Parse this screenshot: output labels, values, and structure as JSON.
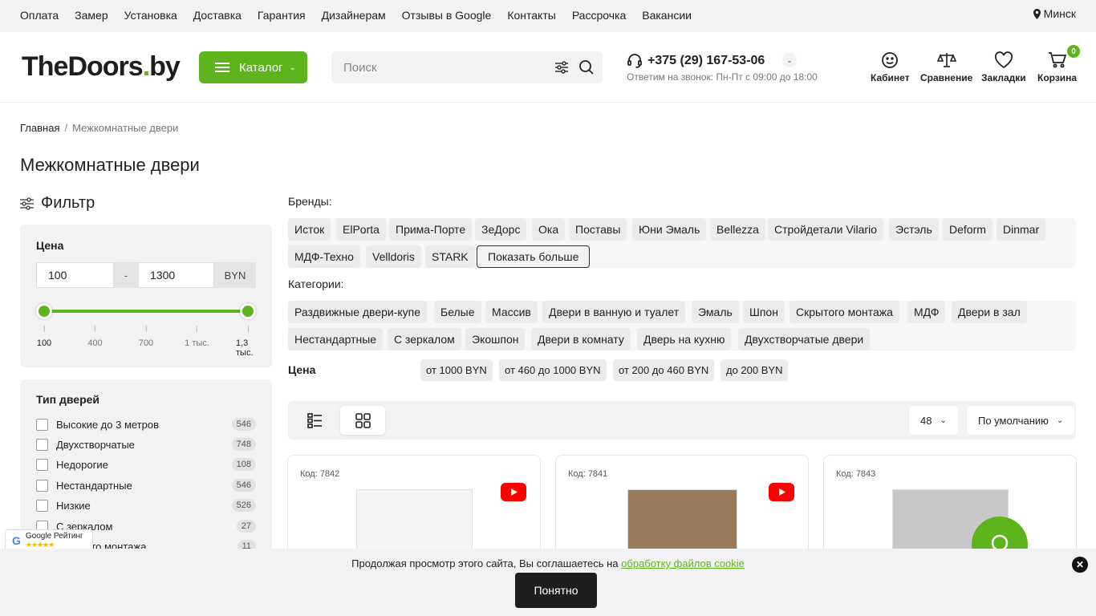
{
  "topnav": {
    "links": [
      "Оплата",
      "Замер",
      "Установка",
      "Доставка",
      "Гарантия",
      "Дизайнерам",
      "Отзывы в Google",
      "Контакты",
      "Рассрочка",
      "Вакансии"
    ],
    "city": "Минск"
  },
  "header": {
    "logo_main": "TheDoors",
    "logo_dot": ".",
    "logo_tld": "by",
    "catalog_label": "Каталог",
    "search_placeholder": "Поиск",
    "phone": "+375 (29) 167-53-06",
    "hours": "Ответим на звонок: Пн-Пт с 09:00 до 18:00",
    "cabinet": "Кабинет",
    "compare": "Сравнение",
    "bookmarks": "Закладки",
    "cart": "Корзина",
    "cart_count": "0"
  },
  "breadcrumb": {
    "home": "Главная",
    "sep": "/",
    "current": "Межкомнатные двери"
  },
  "page_title": "Межкомнатные двери",
  "filter": {
    "title": "Фильтр",
    "price": {
      "title": "Цена",
      "min": "100",
      "dash": "-",
      "max": "1300",
      "currency": "BYN",
      "range_fraction": [
        0,
        1
      ],
      "ticks": [
        "100",
        "400",
        "700",
        "1 тыс.",
        "1,3 тыс."
      ]
    },
    "door_type": {
      "title": "Тип дверей",
      "items": [
        {
          "label": "Высокие до 3 метров",
          "count": "546"
        },
        {
          "label": "Двухстворчатые",
          "count": "748"
        },
        {
          "label": "Недорогие",
          "count": "108"
        },
        {
          "label": "Нестандартные",
          "count": "546"
        },
        {
          "label": "Низкие",
          "count": "526"
        },
        {
          "label": "С зеркалом",
          "count": "27"
        },
        {
          "label": "Скрытого монтажа",
          "count": "11"
        }
      ]
    }
  },
  "brands": {
    "label": "Бренды:",
    "items": [
      "Исток",
      "ElPorta",
      "Прима-Порте",
      "ЗеДорс",
      "Ока",
      "Поставы",
      "Юни Эмаль",
      "Bellezza",
      "Стройдетали Vilario",
      "Эстэль",
      "Deform",
      "Dinmar",
      "МДФ-Техно",
      "Velldoris",
      "STARK"
    ],
    "more": "Показать больше"
  },
  "categories": {
    "label": "Категории:",
    "items": [
      "Раздвижные двери-купе",
      "Белые",
      "Массив",
      "Двери в ванную и туалет",
      "Эмаль",
      "Шпон",
      "Скрытого монтажа",
      "МДФ",
      "Двери в зал",
      "Нестандартные",
      "С зеркалом",
      "Экошпон",
      "Двери в комнату",
      "Дверь на кухню",
      "Двухстворчатые двери"
    ]
  },
  "price_quick": {
    "label": "Цена",
    "items": [
      "от 1000 BYN",
      "от 460 до 1000 BYN",
      "от 200 до 460 BYN",
      "до 200 BYN"
    ]
  },
  "toolbar": {
    "per_page": "48",
    "sort": "По умолчанию"
  },
  "products": [
    {
      "code": "Код: 7842",
      "door_color": "#f4f4f4"
    },
    {
      "code": "Код: 7841",
      "door_color": "#9a7a5c"
    },
    {
      "code": "Код: 7843",
      "door_color": "#c8c8c8"
    }
  ],
  "google": {
    "name": "Google Рейтинг",
    "stars": "★★★★★"
  },
  "cookie": {
    "text": "Продолжая просмотр этого сайта, Вы соглашаетесь на ",
    "link": "обработку файлов cookie",
    "ok": "Понятно",
    "close": "✕"
  },
  "colors": {
    "accent": "#5db41d",
    "dark": "#1e1e1e",
    "panel": "#f2f2f4",
    "youtube": "#ff0000"
  }
}
